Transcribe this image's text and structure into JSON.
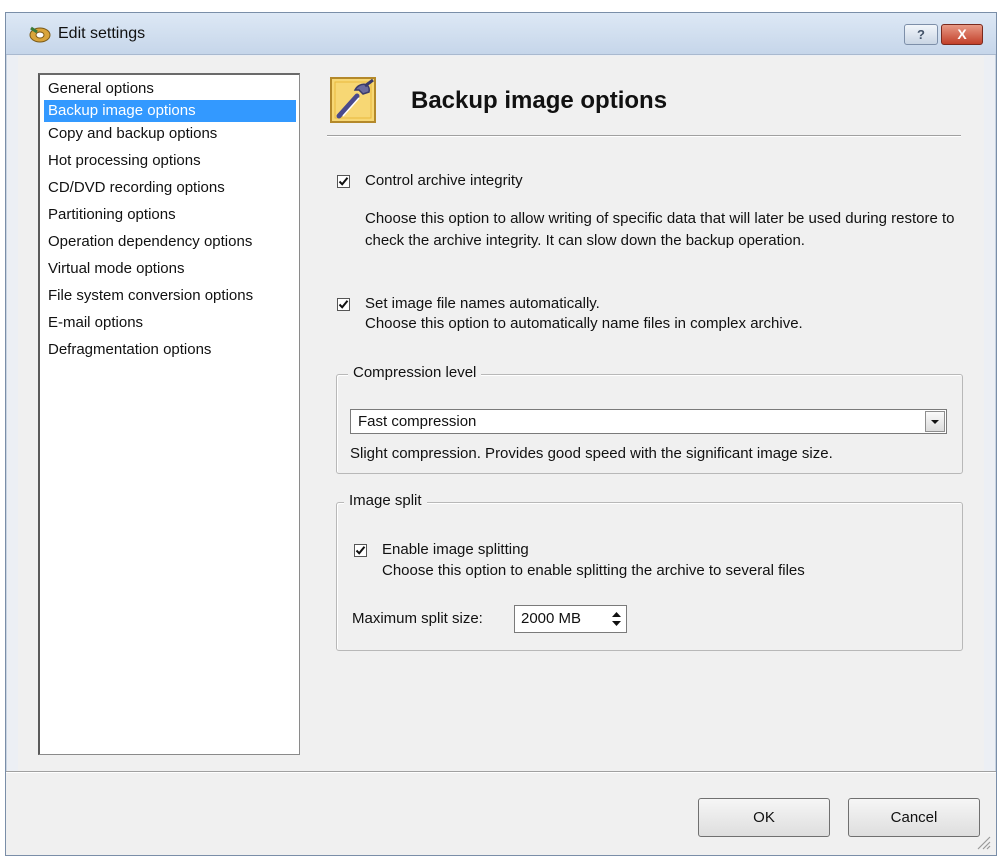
{
  "window": {
    "title": "Edit settings",
    "help_glyph": "?",
    "close_glyph": "X"
  },
  "nav": {
    "items": [
      {
        "label": "General options",
        "selected": false
      },
      {
        "label": "Backup image options",
        "selected": true
      },
      {
        "label": "Copy and backup options",
        "selected": false
      },
      {
        "label": "Hot processing options",
        "selected": false
      },
      {
        "label": "CD/DVD recording options",
        "selected": false
      },
      {
        "label": "Partitioning options",
        "selected": false
      },
      {
        "label": "Operation dependency options",
        "selected": false
      },
      {
        "label": "Virtual mode options",
        "selected": false
      },
      {
        "label": "File system conversion options",
        "selected": false
      },
      {
        "label": "E-mail options",
        "selected": false
      },
      {
        "label": "Defragmentation options",
        "selected": false
      }
    ]
  },
  "panel": {
    "title": "Backup image options",
    "icon": "settings-tools-icon"
  },
  "options": {
    "control_integrity": {
      "label": "Control archive integrity",
      "checked": true,
      "description": "Choose this option to allow writing of specific data that will later be used during restore to check the archive integrity. It can slow down the backup operation."
    },
    "auto_names": {
      "label": "Set image file names automatically.",
      "checked": true,
      "description": "Choose this option to automatically name files in complex archive."
    }
  },
  "compression": {
    "legend": "Compression level",
    "selected": "Fast compression",
    "description": "Slight compression. Provides good speed with the significant image size."
  },
  "image_split": {
    "legend": "Image split",
    "enable_label": "Enable image splitting",
    "enable_checked": true,
    "description": "Choose this option to enable splitting the archive to several files",
    "max_size_label": "Maximum split size:",
    "max_size_value": "2000 MB"
  },
  "buttons": {
    "ok": "OK",
    "cancel": "Cancel"
  },
  "colors": {
    "selection": "#3399ff",
    "close_button": "#c2402a",
    "titlebar": "#c6d6ea"
  }
}
